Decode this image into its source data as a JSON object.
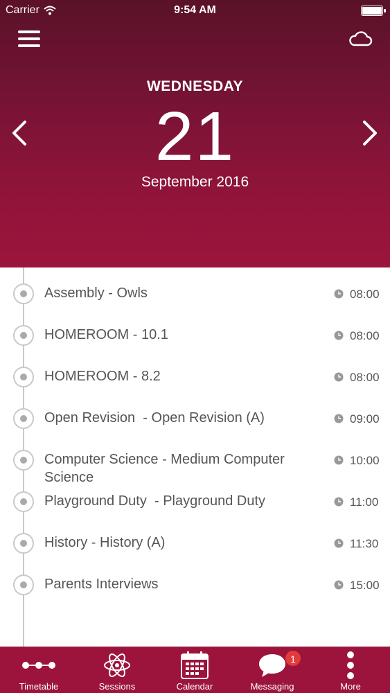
{
  "status_bar": {
    "carrier": "Carrier",
    "time": "9:54 AM"
  },
  "day": {
    "weekday": "WEDNESDAY",
    "date": "21",
    "month_year": "September 2016"
  },
  "icons": {
    "menu": "hamburger-menu-icon",
    "sync": "cloud-icon",
    "prev": "chevron-left-icon",
    "next": "chevron-right-icon",
    "event_time": "clock-icon"
  },
  "events": [
    {
      "title": "Assembly - Owls",
      "time": "08:00"
    },
    {
      "title": "HOMEROOM - 10.1",
      "time": "08:00"
    },
    {
      "title": "HOMEROOM - 8.2",
      "time": "08:00"
    },
    {
      "title": "Open Revision  - Open Revision (A)",
      "time": "09:00"
    },
    {
      "title": "Computer Science - Medium Computer Science",
      "time": "10:00"
    },
    {
      "title": "Playground Duty  - Playground Duty",
      "time": "11:00"
    },
    {
      "title": "History - History (A)",
      "time": "11:30"
    },
    {
      "title": "Parents Interviews",
      "time": "15:00"
    }
  ],
  "tabs": [
    {
      "label": "Timetable",
      "icon": "timeline-icon"
    },
    {
      "label": "Sessions",
      "icon": "atom-icon"
    },
    {
      "label": "Calendar",
      "icon": "calendar-icon"
    },
    {
      "label": "Messaging",
      "icon": "chat-bubble-icon",
      "badge": "1"
    },
    {
      "label": "More",
      "icon": "more-vertical-icon"
    }
  ],
  "colors": {
    "header_top": "#5a1228",
    "header_bottom": "#9c143c",
    "tab_bar": "#9c143c",
    "badge": "#e23b3b",
    "timeline": "#c9c9c9",
    "event_text": "#555555"
  }
}
